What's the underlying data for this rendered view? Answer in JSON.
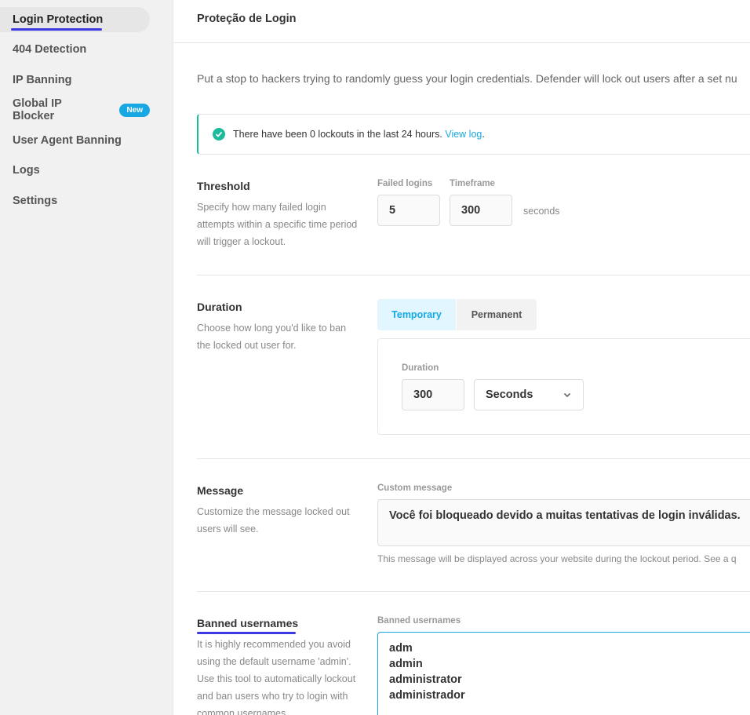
{
  "sidebar": {
    "items": [
      {
        "label": "Login Protection"
      },
      {
        "label": "404 Detection"
      },
      {
        "label": "IP Banning"
      },
      {
        "label": "Global IP Blocker",
        "badge": "New"
      },
      {
        "label": "User Agent Banning"
      },
      {
        "label": "Logs"
      },
      {
        "label": "Settings"
      }
    ]
  },
  "header": {
    "title": "Proteção de Login"
  },
  "intro": "Put a stop to hackers trying to randomly guess your login credentials. Defender will lock out users after a set nu",
  "notice": {
    "text": "There have been 0 lockouts in the last 24 hours.",
    "link": "View log",
    "suffix": "."
  },
  "threshold": {
    "title": "Threshold",
    "desc": "Specify how many failed login attempts within a specific time period will trigger a lockout.",
    "failed_label": "Failed logins",
    "failed_value": "5",
    "timeframe_label": "Timeframe",
    "timeframe_value": "300",
    "unit": "seconds"
  },
  "duration": {
    "title": "Duration",
    "desc": "Choose how long you'd like to ban the locked out user for.",
    "tabs": [
      "Temporary",
      "Permanent"
    ],
    "field_label": "Duration",
    "value": "300",
    "unit_selected": "Seconds"
  },
  "message": {
    "title": "Message",
    "desc": "Customize the message locked out users will see.",
    "field_label": "Custom message",
    "value": "Você foi bloqueado devido a muitas tentativas de login inválidas.",
    "hint": "This message will be displayed across your website during the lockout period. See a q"
  },
  "banned": {
    "title": "Banned usernames",
    "desc": "It is highly recommended you avoid using the default username 'admin'. Use this tool to automatically lockout and ban users who try to login with common usernames.",
    "field_label": "Banned usernames",
    "lines": [
      "adm",
      "admin",
      "administrator",
      "administrador"
    ]
  },
  "colors": {
    "accent": "#17a8e3",
    "success": "#1abc9c",
    "underline": "#3a3ae0"
  }
}
